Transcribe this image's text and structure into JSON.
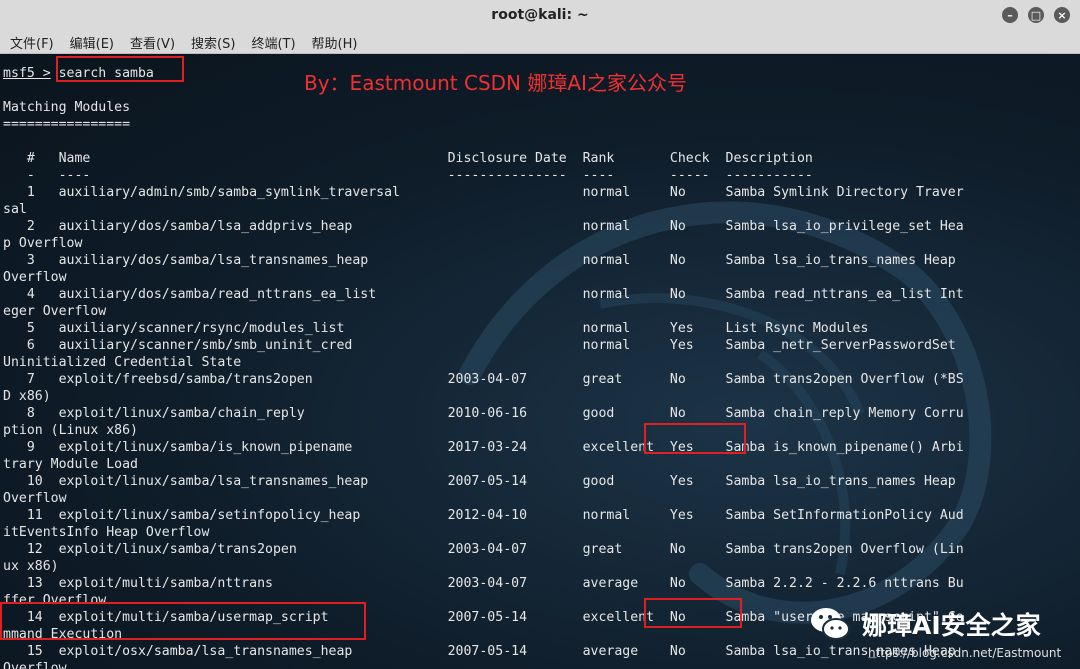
{
  "window": {
    "title": "root@kali: ~"
  },
  "menu": [
    "文件(F)",
    "编辑(E)",
    "查看(V)",
    "搜索(S)",
    "终端(T)",
    "帮助(H)"
  ],
  "terminal": {
    "prompt": "msf5 >",
    "command": "search samba",
    "lines": [
      "",
      "Matching Modules",
      "================",
      "",
      "   #   Name                                             Disclosure Date  Rank       Check  Description",
      "   -   ----                                             ---------------  ----       -----  -----------",
      "   1   auxiliary/admin/smb/samba_symlink_traversal                       normal     No     Samba Symlink Directory Traver",
      "sal",
      "   2   auxiliary/dos/samba/lsa_addprivs_heap                             normal     No     Samba lsa_io_privilege_set Hea",
      "p Overflow",
      "   3   auxiliary/dos/samba/lsa_transnames_heap                           normal     No     Samba lsa_io_trans_names Heap",
      "Overflow",
      "   4   auxiliary/dos/samba/read_nttrans_ea_list                          normal     No     Samba read_nttrans_ea_list Int",
      "eger Overflow",
      "   5   auxiliary/scanner/rsync/modules_list                              normal     Yes    List Rsync Modules",
      "   6   auxiliary/scanner/smb/smb_uninit_cred                             normal     Yes    Samba _netr_ServerPasswordSet",
      "Uninitialized Credential State",
      "   7   exploit/freebsd/samba/trans2open                 2003-04-07       great      No     Samba trans2open Overflow (*BS",
      "D x86)",
      "   8   exploit/linux/samba/chain_reply                  2010-06-16       good       No     Samba chain_reply Memory Corru",
      "ption (Linux x86)",
      "   9   exploit/linux/samba/is_known_pipename            2017-03-24       excellent  Yes    Samba is_known_pipename() Arbi",
      "trary Module Load",
      "   10  exploit/linux/samba/lsa_transnames_heap          2007-05-14       good       Yes    Samba lsa_io_trans_names Heap",
      "Overflow",
      "   11  exploit/linux/samba/setinfopolicy_heap           2012-04-10       normal     Yes    Samba SetInformationPolicy Aud",
      "itEventsInfo Heap Overflow",
      "   12  exploit/linux/samba/trans2open                   2003-04-07       great      No     Samba trans2open Overflow (Lin",
      "ux x86)",
      "   13  exploit/multi/samba/nttrans                      2003-04-07       average    No     Samba 2.2.2 - 2.2.6 nttrans Bu",
      "ffer Overflow",
      "   14  exploit/multi/samba/usermap_script               2007-05-14       excellent  No     Samba \"username map script\" Co",
      "mmand Execution",
      "   15  exploit/osx/samba/lsa_transnames_heap            2007-05-14       average    No     Samba lsa_io_trans_names Heap",
      "Overflow"
    ]
  },
  "watermark": "By：Eastmount CSDN 娜璋AI之家公众号",
  "logo_text": "娜璋AI安全之家",
  "url": "https://blog.csdn.net/Eastmount",
  "colors": {
    "terminal_bg": "#0e1a24",
    "text": "#e6e6e6",
    "highlight": "#e02020",
    "watermark": "#f03030"
  }
}
